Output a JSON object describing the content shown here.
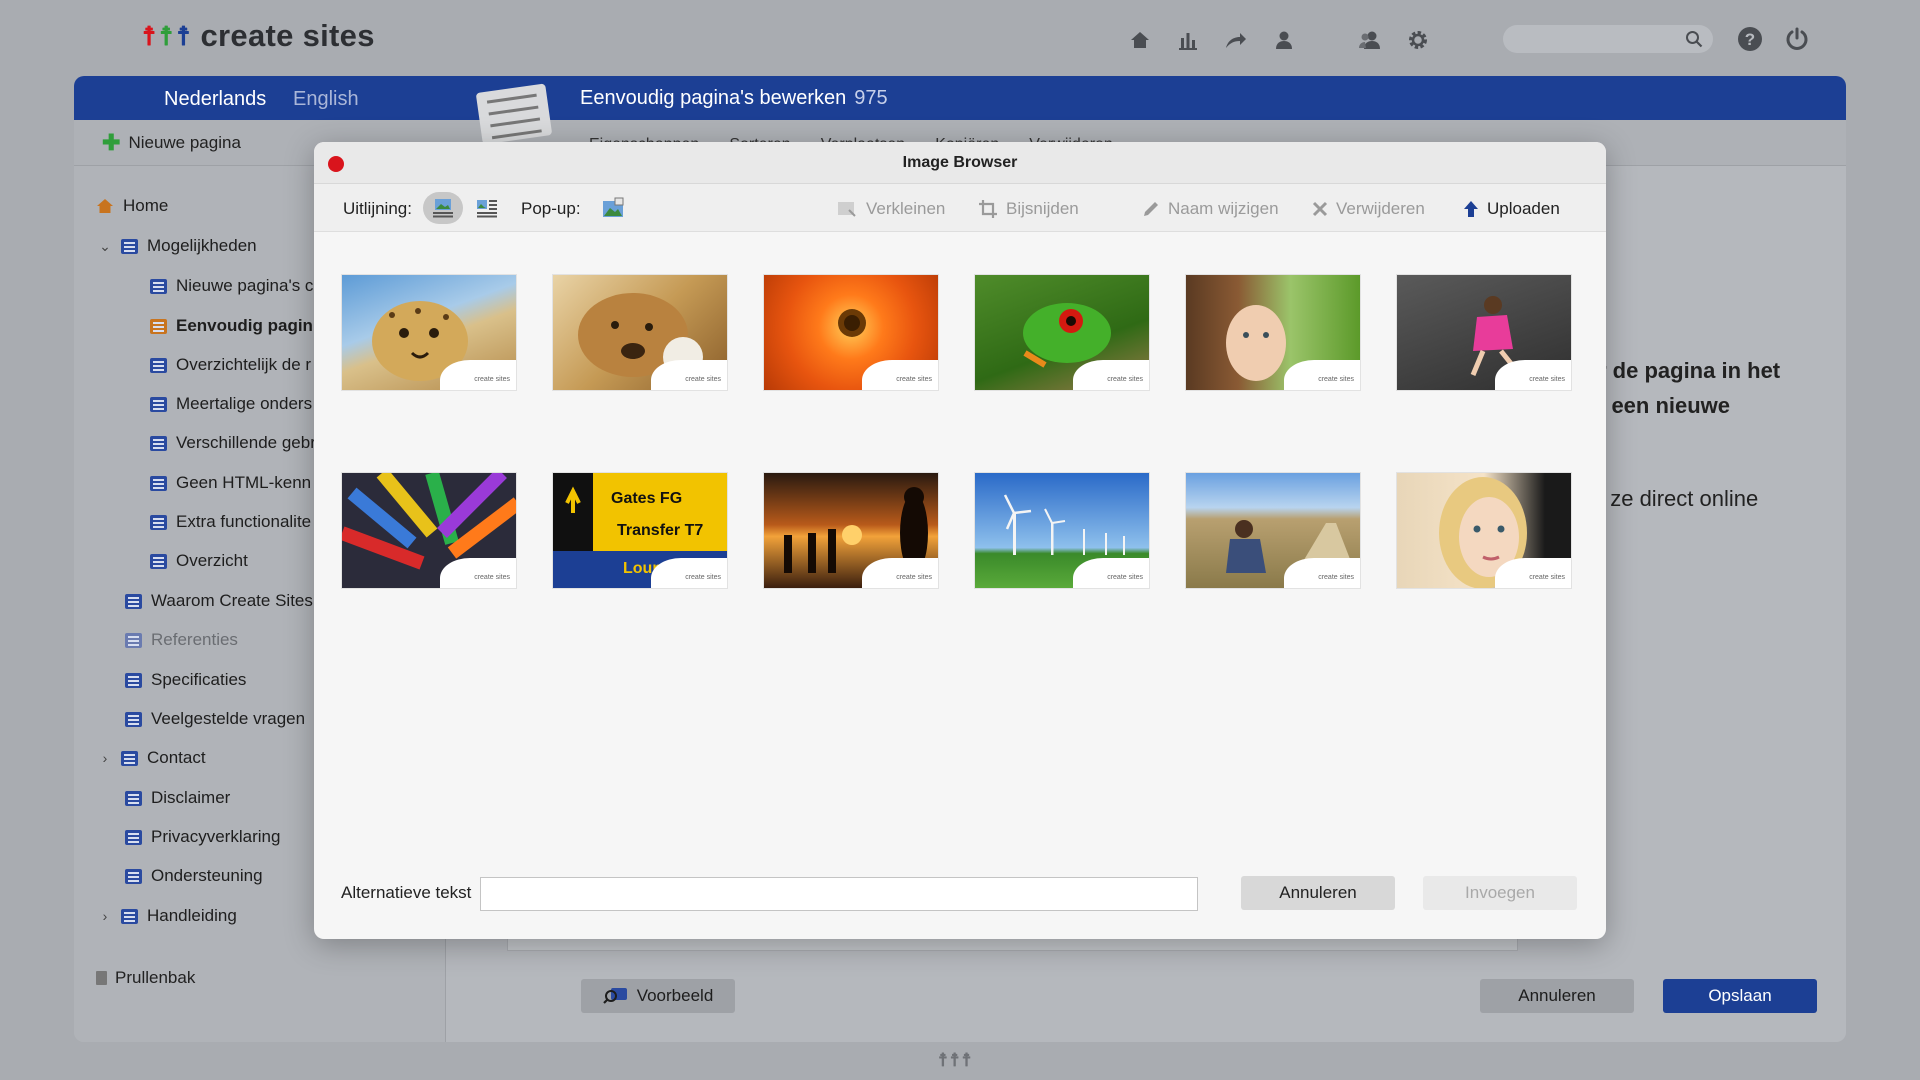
{
  "brand": {
    "name": "create sites"
  },
  "header": {
    "search_placeholder": "",
    "icons": [
      "home-icon",
      "stats-icon",
      "share-icon",
      "user-icon",
      "users-icon",
      "settings-icon",
      "search-icon",
      "help-icon",
      "power-icon"
    ]
  },
  "languages": {
    "primary": "Nederlands",
    "secondary": "English"
  },
  "page_editor": {
    "title": "Eenvoudig pagina's bewerken",
    "page_number": "975",
    "new_page_label": "Nieuwe pagina",
    "toolbar_partial": [
      "Eigenschappen",
      "Sorteren",
      "Verplaatsen",
      "Kopiëren",
      "Verwijderen"
    ],
    "preview_label": "Voorbeeld",
    "cancel_label": "Annuleren",
    "save_label": "Opslaan",
    "trash_label": "Prullenbak",
    "content_lines": [
      "r de pagina in het",
      "f een nieuwe",
      "t ze direct online"
    ]
  },
  "sidebar": {
    "items": [
      {
        "label": "Home"
      },
      {
        "label": "Mogelijkheden"
      },
      {
        "label": "Nieuwe pagina's c"
      },
      {
        "label": "Eenvoudig pagin"
      },
      {
        "label": "Overzichtelijk de r"
      },
      {
        "label": "Meertalige onders"
      },
      {
        "label": "Verschillende gebr"
      },
      {
        "label": "Geen HTML-kenn"
      },
      {
        "label": "Extra functionalite"
      },
      {
        "label": "Overzicht"
      },
      {
        "label": "Waarom Create Sites"
      },
      {
        "label": "Referenties"
      },
      {
        "label": "Specificaties"
      },
      {
        "label": "Veelgestelde vragen"
      },
      {
        "label": "Contact"
      },
      {
        "label": "Disclaimer"
      },
      {
        "label": "Privacyverklaring"
      },
      {
        "label": "Ondersteuning"
      },
      {
        "label": "Handleiding"
      }
    ]
  },
  "modal": {
    "title": "Image Browser",
    "alignment_label": "Uitlijning:",
    "popup_label": "Pop-up:",
    "actions": {
      "shrink": "Verkleinen",
      "crop": "Bijsnijden",
      "rename": "Naam wijzigen",
      "delete": "Verwijderen",
      "upload": "Uploaden"
    },
    "thumb_badge": "create sites",
    "images": [
      {
        "icon": "cheetah-image"
      },
      {
        "icon": "dog-image"
      },
      {
        "icon": "orange-flower-image"
      },
      {
        "icon": "tree-frog-image"
      },
      {
        "icon": "girl-portrait-image"
      },
      {
        "icon": "girl-running-image"
      },
      {
        "icon": "colored-pencils-image"
      },
      {
        "icon": "airport-sign-image"
      },
      {
        "icon": "sunset-silhouettes-image"
      },
      {
        "icon": "wind-turbines-image"
      },
      {
        "icon": "man-sitting-path-image"
      },
      {
        "icon": "blonde-woman-image"
      }
    ],
    "alt_text_label": "Alternatieve tekst",
    "alt_text_value": "",
    "cancel_label": "Annuleren",
    "insert_label": "Invoegen"
  },
  "colors": {
    "primary_blue": "#1c3f94",
    "close_red": "#d9141c",
    "add_green": "#2f9e3a",
    "delete_red": "#cc1a1a"
  }
}
